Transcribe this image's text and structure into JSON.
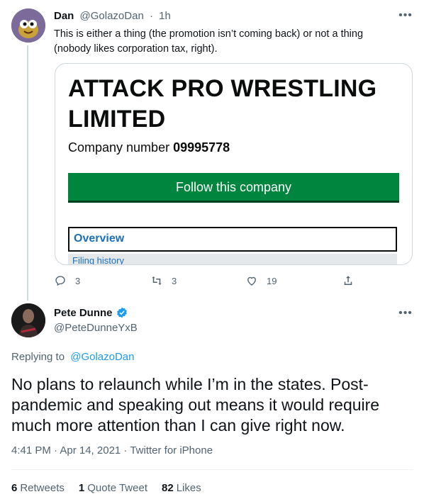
{
  "parent": {
    "name": "Dan",
    "handle": "@GolazoDan",
    "sep": "·",
    "time": "1h",
    "text": "This is either a thing (the promotion isn’t coming back) or not a thing (nobody likes corporation tax, right).",
    "card": {
      "title": "ATTACK PRO WRESTLING LIMITED",
      "company_number_label": "Company number",
      "company_number": "09995778",
      "follow_label": "Follow this company",
      "overview_label": "Overview",
      "filing_label": "Filing history"
    },
    "actions": {
      "replies": "3",
      "retweets": "3",
      "likes": "19"
    }
  },
  "reply": {
    "name": "Pete Dunne",
    "handle": "@PeteDunneYxB",
    "replying_prefix": "Replying to",
    "replying_to": "@GolazoDan",
    "text": "No plans to relaunch while I’m in the states. Post-pandemic and speaking out means it would require much more attention than I can give right now.",
    "time": "4:41 PM · Apr 14, 2021 · ",
    "source": "Twitter for iPhone",
    "stats": {
      "retweets_count": "6",
      "retweets_label": "Retweets",
      "quotes_count": "1",
      "quotes_label": "Quote Tweet",
      "likes_count": "82",
      "likes_label": "Likes"
    }
  },
  "colors": {
    "accent": "#1d9bf0",
    "govuk_green": "#00853f",
    "govuk_link": "#1d70b8"
  },
  "icons": [
    "more-icon",
    "reply-icon",
    "retweet-icon",
    "like-icon",
    "share-icon",
    "verified-icon"
  ]
}
